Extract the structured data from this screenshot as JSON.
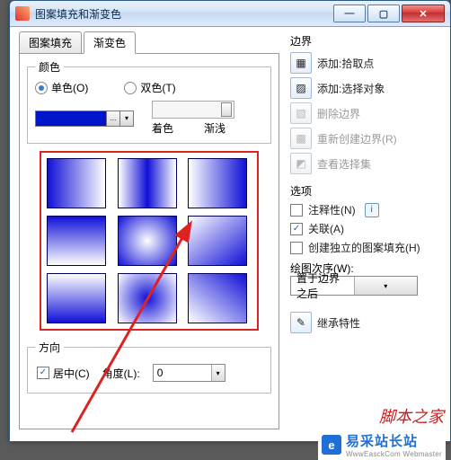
{
  "window": {
    "title": "图案填充和渐变色"
  },
  "tabs": [
    "图案填充",
    "渐变色"
  ],
  "activeTab": 1,
  "color": {
    "legend": "颜色",
    "single": "单色(O)",
    "double": "双色(T)",
    "mode": "single",
    "swatch_hex": "#0015c9",
    "slider_left": "着色",
    "slider_right": "渐浅"
  },
  "direction": {
    "legend": "方向",
    "center_label": "居中(C)",
    "center_checked": true,
    "angle_label": "角度(L):",
    "angle_value": "0"
  },
  "boundary": {
    "legend": "边界",
    "items": [
      {
        "icon": "add-pick-icon",
        "label": "添加:拾取点",
        "enabled": true
      },
      {
        "icon": "add-select-icon",
        "label": "添加:选择对象",
        "enabled": true
      },
      {
        "icon": "delete-icon",
        "label": "删除边界",
        "enabled": false
      },
      {
        "icon": "recreate-icon",
        "label": "重新创建边界(R)",
        "enabled": false
      },
      {
        "icon": "view-icon",
        "label": "查看选择集",
        "enabled": false
      }
    ]
  },
  "options": {
    "legend": "选项",
    "annot_label": "注释性(N)",
    "annot_checked": false,
    "assoc_label": "关联(A)",
    "assoc_checked": true,
    "indep_label": "创建独立的图案填充(H)",
    "indep_checked": false,
    "order_label": "绘图次序(W):",
    "order_value": "置于边界之后"
  },
  "inherit": {
    "label": "继承特性"
  },
  "watermark": "脚本之家",
  "footer": {
    "brand": "易采站长站",
    "url": "WwwEasckCom Webmaster"
  }
}
